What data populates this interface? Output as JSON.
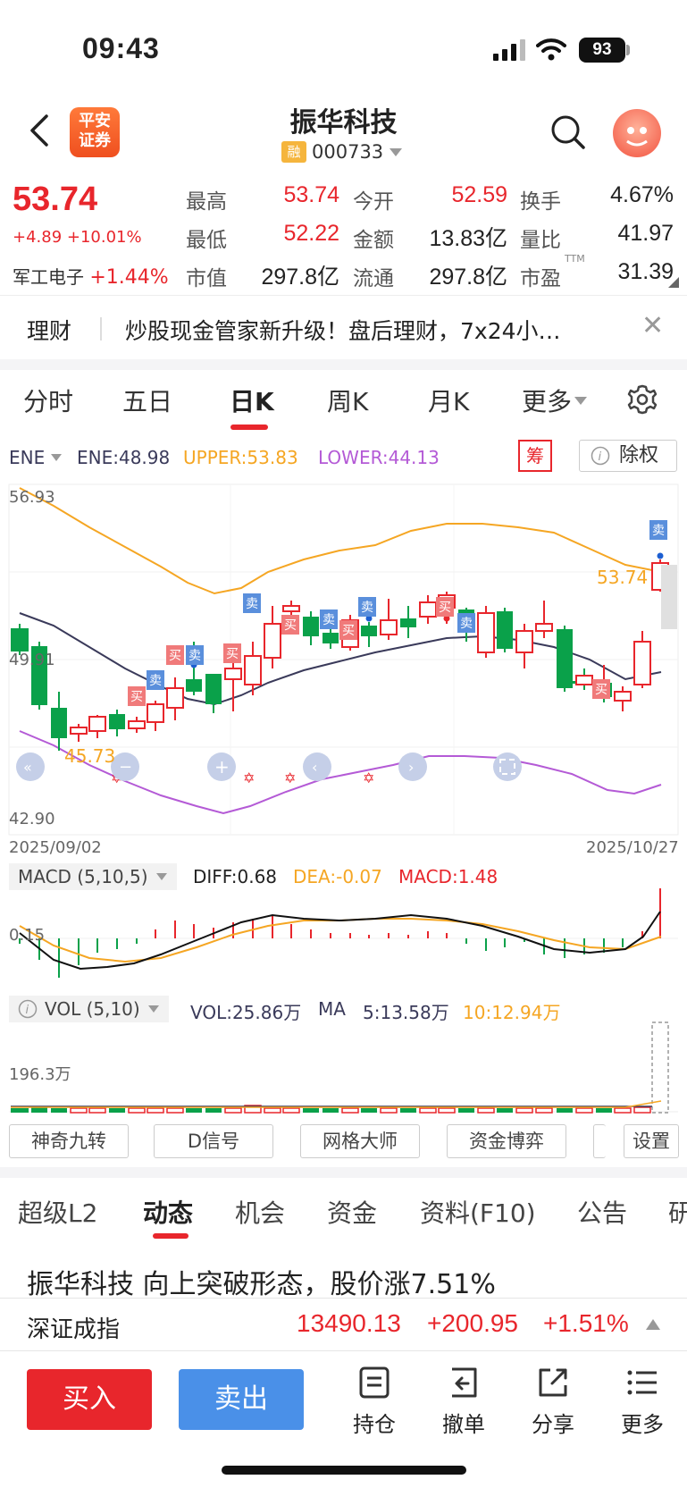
{
  "status_bar": {
    "time": "09:43",
    "battery": "93"
  },
  "header": {
    "logo_text_1": "平安",
    "logo_text_2": "证券",
    "title": "振华科技",
    "badge": "融",
    "code": "000733",
    "icons": [
      "back-chevron-icon",
      "search-icon",
      "avatar-icon",
      "dropdown-caret-icon"
    ]
  },
  "quote": {
    "price": "53.74",
    "change": "+4.89 +10.01%",
    "sector_name": "军工电子",
    "sector_change": "+1.44%",
    "high_label": "最高",
    "high": "53.74",
    "open_label": "今开",
    "open": "52.59",
    "turnover_label": "换手",
    "turnover": "4.67%",
    "low_label": "最低",
    "low": "52.22",
    "amount_label": "金额",
    "amount": "13.83亿",
    "volratio_label": "量比",
    "volratio": "41.97",
    "mcap_label": "市值",
    "mcap": "297.8亿",
    "float_label": "流通",
    "float": "297.8亿",
    "pe_label": "市盈",
    "pe_sup": "TTM",
    "pe": "31.39"
  },
  "banner": {
    "label": "理财",
    "text": "炒股现金管家新升级！盘后理财，7x24小…",
    "close": "✕"
  },
  "period_tabs": [
    "分时",
    "五日",
    "日K",
    "周K",
    "月K",
    "更多"
  ],
  "indicator": {
    "name": "ENE",
    "ene": "ENE:48.98",
    "upper": "UPPER:53.83",
    "lower": "LOWER:44.13",
    "chou": "筹",
    "chuquan": "除权"
  },
  "kline": {
    "y_top": "56.93",
    "y_mid": "49.91",
    "y_bottom": "42.90",
    "low_mark": "45.73",
    "high_mark": "53.74",
    "date_start": "2025/09/02",
    "date_end": "2025/10/27",
    "buy_tag": "买",
    "sell_tag": "卖",
    "colors": {
      "up": "#e8262c",
      "down": "#0aa14a",
      "upper": "#f5a623",
      "lower": "#b45ad6",
      "ene": "#3a3a5a"
    }
  },
  "macd": {
    "name": "MACD (5,10,5)",
    "diff": "DIFF:0.68",
    "dea": "DEA:-0.07",
    "macd": "MACD:1.48",
    "y_label": "0.15"
  },
  "vol": {
    "name": "VOL (5,10)",
    "vol": "VOL:25.86万",
    "ma": "MA",
    "ma5": "5:13.58万",
    "ma10": "10:12.94万",
    "y_label": "196.3万"
  },
  "tool_buttons": [
    "神奇九转",
    "D信号",
    "网格大师",
    "资金博弈",
    "设置"
  ],
  "news_tabs": [
    "超级L2",
    "动态",
    "机会",
    "资金",
    "资料(F10)",
    "公告",
    "研"
  ],
  "news_headline": "振华科技 向上突破形态，股价涨7.51%",
  "index_bar": {
    "name": "深证成指",
    "value": "13490.13",
    "change": "+200.95",
    "pct": "+1.51%"
  },
  "bottom_bar": {
    "buy": "买入",
    "sell": "卖出",
    "hold": "持仓",
    "cancel": "撤单",
    "share": "分享",
    "more": "更多"
  }
}
